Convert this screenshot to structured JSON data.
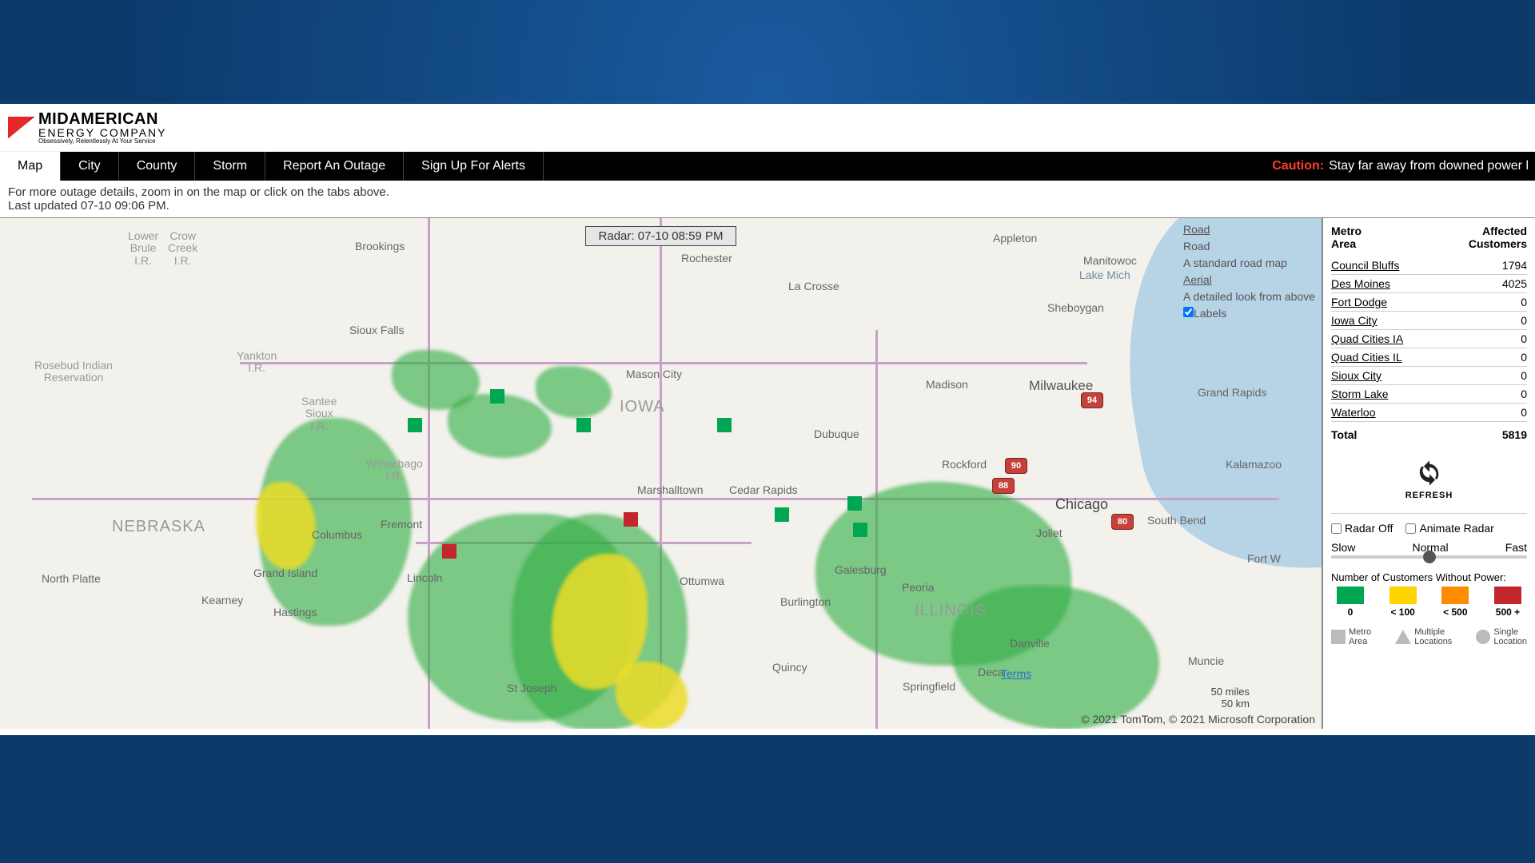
{
  "logo": {
    "line1": "MIDAMERICAN",
    "line2": "ENERGY COMPANY",
    "tagline": "Obsessively, Relentlessly At Your Service"
  },
  "nav": {
    "items": [
      "Map",
      "City",
      "County",
      "Storm",
      "Report An Outage",
      "Sign Up For Alerts"
    ],
    "active_index": 0,
    "caution_label": "Caution:",
    "caution_msg": "Stay far away from downed power l"
  },
  "info": {
    "line1": "For more outage details, zoom in on the map or click on the tabs above.",
    "line2": "Last updated 07-10 09:06 PM."
  },
  "map": {
    "radar_time": "Radar: 07-10 08:59 PM",
    "modes": {
      "road_title": "Road",
      "road_sub": "A standard road map",
      "aerial_title": "Aerial",
      "aerial_sub": "A detailed look from above",
      "labels": "Labels"
    },
    "states": {
      "iowa": "IOWA",
      "nebraska": "NEBRASKA",
      "illinois": "ILLINOIS"
    },
    "reservations": {
      "lower_brule": "Lower\nBrule\nI.R.",
      "crow_creek": "Crow\nCreek\nI.R.",
      "rosebud": "Rosebud Indian\nReservation",
      "yankton": "Yankton\nI.R.",
      "santee": "Santee\nSioux\nI.R.",
      "winnebago": "Winnebago\nI.R."
    },
    "cities": {
      "brookings": "Brookings",
      "sioux_falls": "Sioux Falls",
      "rochester": "Rochester",
      "la_crosse": "La Crosse",
      "appleton": "Appleton",
      "manitowoc": "Manitowoc",
      "sheboygan": "Sheboygan",
      "mason_city": "Mason City",
      "madison": "Madison",
      "milwaukee": "Milwaukee",
      "grand_rapids": "Grand Rapids",
      "lake_mich": "Lake Mich",
      "marshalltown": "Marshalltown",
      "cedar_rapids": "Cedar Rapids",
      "dubuque": "Dubuque",
      "rockford": "Rockford",
      "kalamazoo": "Kalamazoo",
      "fremont": "Fremont",
      "columbus": "Columbus",
      "lincoln": "Lincoln",
      "grand_island": "Grand Island",
      "kearney": "Kearney",
      "hastings": "Hastings",
      "north_platte": "North Platte",
      "ottumwa": "Ottumwa",
      "galesburg": "Galesburg",
      "burlington": "Burlington",
      "peoria": "Peoria",
      "quincy": "Quincy",
      "springfield": "Springfield",
      "decatur": "Deca",
      "danville": "Danville",
      "joliet": "Joliet",
      "south_bend": "South Bend",
      "muncie": "Muncie",
      "st_joseph": "St Joseph",
      "fort_w": "Fort W",
      "chicago": "Chicago",
      "terms": "Terms"
    },
    "shields": {
      "i94": "94",
      "i88": "88",
      "i80": "80",
      "i90": "90"
    },
    "scale": {
      "miles": "50 miles",
      "km": "50 km"
    },
    "attribution": "© 2021 TomTom, © 2021 Microsoft Corporation"
  },
  "sidebar": {
    "col1": "Metro\nArea",
    "col2": "Affected\nCustomers",
    "rows": [
      {
        "name": "Council Bluffs",
        "count": "1794"
      },
      {
        "name": "Des Moines",
        "count": "4025"
      },
      {
        "name": "Fort Dodge",
        "count": "0"
      },
      {
        "name": "Iowa City",
        "count": "0"
      },
      {
        "name": "Quad Cities IA",
        "count": "0"
      },
      {
        "name": "Quad Cities IL",
        "count": "0"
      },
      {
        "name": "Sioux City",
        "count": "0"
      },
      {
        "name": "Storm Lake",
        "count": "0"
      },
      {
        "name": "Waterloo",
        "count": "0"
      }
    ],
    "total_label": "Total",
    "total_value": "5819",
    "refresh": "REFRESH",
    "radar_off": "Radar Off",
    "animate_radar": "Animate Radar",
    "speed": {
      "slow": "Slow",
      "normal": "Normal",
      "fast": "Fast"
    },
    "legend_title": "Number of Customers Without Power:",
    "legend": {
      "g": "0",
      "y": "< 100",
      "o": "< 500",
      "r": "500 +"
    },
    "shapes": {
      "metro": "Metro\nArea",
      "multi": "Multiple\nLocations",
      "single": "Single\nLocation"
    }
  }
}
